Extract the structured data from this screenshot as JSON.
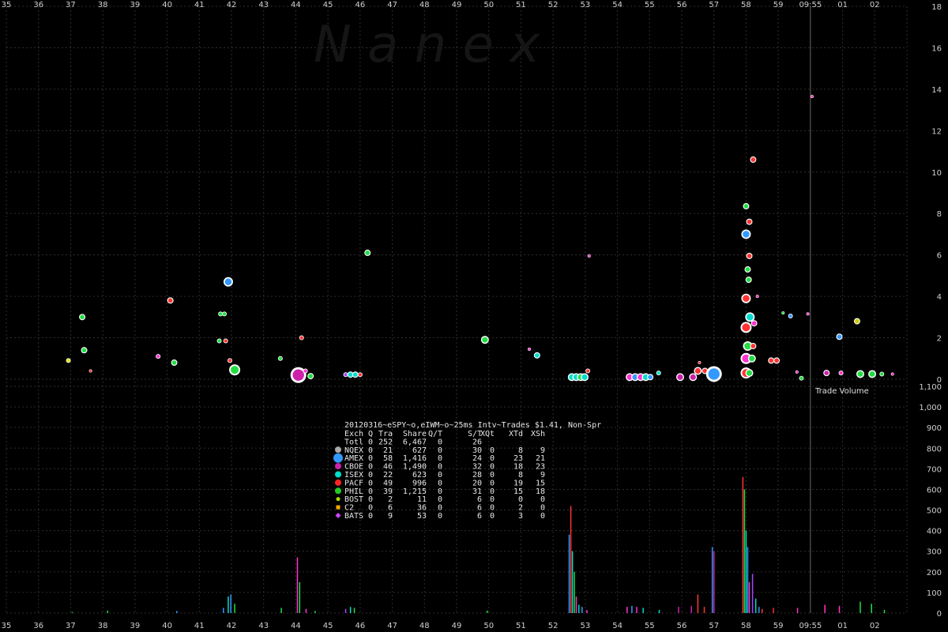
{
  "watermark": "Nanex",
  "chart_data": [
    {
      "type": "scatter",
      "title": "20120316~eSPY~o,eIWM~o~25ms Intv~Trades $1.41, Non-Spr",
      "x_tick_labels": [
        "35",
        "36",
        "37",
        "38",
        "39",
        "40",
        "41",
        "42",
        "43",
        "44",
        "45",
        "46",
        "47",
        "48",
        "49",
        "50",
        "51",
        "52",
        "53",
        "54",
        "55",
        "56",
        "57",
        "58",
        "59",
        "09:55",
        "01",
        "02"
      ],
      "y_tick_labels": [
        "0",
        "2",
        "4",
        "6",
        "8",
        "10",
        "12",
        "14",
        "16",
        "18"
      ],
      "ylim": [
        0,
        18
      ],
      "xlim": [
        0,
        28
      ],
      "marker": {
        "x": 25,
        "label": "09:55"
      },
      "points": [
        {
          "x": 1.93,
          "y": 0.9,
          "size": 3,
          "color": "#e0e000"
        },
        {
          "x": 2.36,
          "y": 3.0,
          "size": 4,
          "color": "#22dd44"
        },
        {
          "x": 2.42,
          "y": 1.4,
          "size": 4,
          "color": "#22dd44"
        },
        {
          "x": 2.62,
          "y": 0.4,
          "size": 2,
          "color": "#ff3333"
        },
        {
          "x": 4.72,
          "y": 1.1,
          "size": 3,
          "color": "#ff33cc"
        },
        {
          "x": 5.1,
          "y": 3.8,
          "size": 4,
          "color": "#ff3333"
        },
        {
          "x": 5.22,
          "y": 0.8,
          "size": 4,
          "color": "#22dd44"
        },
        {
          "x": 6.66,
          "y": 3.15,
          "size": 3,
          "color": "#22dd44"
        },
        {
          "x": 6.78,
          "y": 3.15,
          "size": 3,
          "color": "#22dd44"
        },
        {
          "x": 6.62,
          "y": 1.85,
          "size": 3,
          "color": "#22dd44"
        },
        {
          "x": 6.82,
          "y": 1.85,
          "size": 3,
          "color": "#ff3333"
        },
        {
          "x": 6.9,
          "y": 4.7,
          "size": 6,
          "color": "#3399ff"
        },
        {
          "x": 6.95,
          "y": 0.9,
          "size": 3,
          "color": "#ff3333"
        },
        {
          "x": 7.1,
          "y": 0.45,
          "size": 7,
          "color": "#22dd44"
        },
        {
          "x": 8.52,
          "y": 1.0,
          "size": 3,
          "color": "#22dd44"
        },
        {
          "x": 9.08,
          "y": 0.2,
          "size": 10,
          "color": "#cc22aa"
        },
        {
          "x": 9.3,
          "y": 0.4,
          "size": 3,
          "color": "#ff33cc"
        },
        {
          "x": 9.46,
          "y": 0.15,
          "size": 4,
          "color": "#22dd44"
        },
        {
          "x": 9.18,
          "y": 2.0,
          "size": 3,
          "color": "#ff3333"
        },
        {
          "x": 10.55,
          "y": 0.22,
          "size": 3,
          "color": "#aa44ff"
        },
        {
          "x": 10.7,
          "y": 0.22,
          "size": 4,
          "color": "#00ddcc"
        },
        {
          "x": 10.85,
          "y": 0.22,
          "size": 4,
          "color": "#00ddcc"
        },
        {
          "x": 11.0,
          "y": 0.22,
          "size": 3,
          "color": "#ff3333"
        },
        {
          "x": 11.23,
          "y": 6.1,
          "size": 4,
          "color": "#22dd44"
        },
        {
          "x": 14.88,
          "y": 1.9,
          "size": 5,
          "color": "#22dd44"
        },
        {
          "x": 16.26,
          "y": 1.45,
          "size": 2,
          "color": "#ff33cc"
        },
        {
          "x": 16.5,
          "y": 1.15,
          "size": 4,
          "color": "#00ddcc"
        },
        {
          "x": 17.58,
          "y": 0.1,
          "size": 5,
          "color": "#00ddcc"
        },
        {
          "x": 17.72,
          "y": 0.1,
          "size": 5,
          "color": "#00ddcc"
        },
        {
          "x": 17.86,
          "y": 0.1,
          "size": 5,
          "color": "#22dd44"
        },
        {
          "x": 17.98,
          "y": 0.1,
          "size": 5,
          "color": "#00ddcc"
        },
        {
          "x": 18.08,
          "y": 0.4,
          "size": 3,
          "color": "#ff3333"
        },
        {
          "x": 18.12,
          "y": 5.95,
          "size": 2,
          "color": "#ff33cc"
        },
        {
          "x": 19.38,
          "y": 0.1,
          "size": 5,
          "color": "#ff33cc"
        },
        {
          "x": 19.55,
          "y": 0.1,
          "size": 5,
          "color": "#3399ff"
        },
        {
          "x": 19.72,
          "y": 0.1,
          "size": 5,
          "color": "#ff33cc"
        },
        {
          "x": 19.88,
          "y": 0.1,
          "size": 5,
          "color": "#00ddcc"
        },
        {
          "x": 20.02,
          "y": 0.1,
          "size": 4,
          "color": "#3399ff"
        },
        {
          "x": 20.28,
          "y": 0.3,
          "size": 3,
          "color": "#00ddcc"
        },
        {
          "x": 20.95,
          "y": 0.1,
          "size": 5,
          "color": "#cc22aa"
        },
        {
          "x": 21.35,
          "y": 0.1,
          "size": 5,
          "color": "#cc22aa"
        },
        {
          "x": 21.5,
          "y": 0.4,
          "size": 5,
          "color": "#ff3333"
        },
        {
          "x": 21.55,
          "y": 0.8,
          "size": 2,
          "color": "#ff3333"
        },
        {
          "x": 21.72,
          "y": 0.4,
          "size": 4,
          "color": "#ff3333"
        },
        {
          "x": 22.0,
          "y": 0.25,
          "size": 10,
          "color": "#3399ff"
        },
        {
          "x": 23.0,
          "y": 0.3,
          "size": 7,
          "color": "#ff3333"
        },
        {
          "x": 23.1,
          "y": 0.3,
          "size": 5,
          "color": "#22dd44"
        },
        {
          "x": 23.0,
          "y": 1.0,
          "size": 7,
          "color": "#ff33cc"
        },
        {
          "x": 23.18,
          "y": 1.0,
          "size": 5,
          "color": "#22dd44"
        },
        {
          "x": 23.05,
          "y": 1.6,
          "size": 6,
          "color": "#22dd44"
        },
        {
          "x": 23.22,
          "y": 1.6,
          "size": 4,
          "color": "#ff3333"
        },
        {
          "x": 23.0,
          "y": 2.5,
          "size": 7,
          "color": "#ff3333"
        },
        {
          "x": 23.12,
          "y": 3.0,
          "size": 6,
          "color": "#00ddcc"
        },
        {
          "x": 23.25,
          "y": 2.7,
          "size": 4,
          "color": "#ff33cc"
        },
        {
          "x": 23.0,
          "y": 3.9,
          "size": 6,
          "color": "#ff3333"
        },
        {
          "x": 23.08,
          "y": 4.8,
          "size": 4,
          "color": "#22dd44"
        },
        {
          "x": 23.05,
          "y": 5.3,
          "size": 4,
          "color": "#22dd44"
        },
        {
          "x": 23.1,
          "y": 5.95,
          "size": 4,
          "color": "#ff3333"
        },
        {
          "x": 23.0,
          "y": 7.0,
          "size": 6,
          "color": "#3399ff"
        },
        {
          "x": 23.1,
          "y": 7.6,
          "size": 4,
          "color": "#ff3333"
        },
        {
          "x": 23.0,
          "y": 8.35,
          "size": 4,
          "color": "#22dd44"
        },
        {
          "x": 23.22,
          "y": 10.6,
          "size": 4,
          "color": "#ff3333"
        },
        {
          "x": 23.35,
          "y": 4.0,
          "size": 2,
          "color": "#ff33cc"
        },
        {
          "x": 23.78,
          "y": 0.9,
          "size": 4,
          "color": "#ff3333"
        },
        {
          "x": 23.95,
          "y": 0.9,
          "size": 4,
          "color": "#ff3333"
        },
        {
          "x": 24.15,
          "y": 3.2,
          "size": 2,
          "color": "#22dd44"
        },
        {
          "x": 24.38,
          "y": 3.05,
          "size": 3,
          "color": "#3399ff"
        },
        {
          "x": 24.58,
          "y": 0.35,
          "size": 2,
          "color": "#ff33cc"
        },
        {
          "x": 24.72,
          "y": 0.05,
          "size": 3,
          "color": "#22dd44"
        },
        {
          "x": 24.92,
          "y": 3.15,
          "size": 2,
          "color": "#ff33cc"
        },
        {
          "x": 25.05,
          "y": 13.65,
          "size": 2,
          "color": "#ff33cc"
        },
        {
          "x": 25.5,
          "y": 0.3,
          "size": 4,
          "color": "#cc22aa"
        },
        {
          "x": 25.95,
          "y": 0.3,
          "size": 3,
          "color": "#ff33cc"
        },
        {
          "x": 25.9,
          "y": 2.05,
          "size": 4,
          "color": "#3399ff"
        },
        {
          "x": 26.45,
          "y": 2.8,
          "size": 4,
          "color": "#cccc00"
        },
        {
          "x": 26.55,
          "y": 0.25,
          "size": 5,
          "color": "#22dd44"
        },
        {
          "x": 26.92,
          "y": 0.25,
          "size": 5,
          "color": "#22dd44"
        },
        {
          "x": 27.22,
          "y": 0.25,
          "size": 3,
          "color": "#22dd44"
        },
        {
          "x": 27.55,
          "y": 0.25,
          "size": 2,
          "color": "#ff33cc"
        }
      ]
    },
    {
      "type": "bar",
      "title": "Trade Volume",
      "y_tick_labels": [
        "0",
        "100",
        "200",
        "300",
        "400",
        "500",
        "600",
        "700",
        "800",
        "900",
        "1,000",
        "1,100"
      ],
      "ylim": [
        0,
        1100
      ],
      "bars": [
        {
          "x": 2.05,
          "v": 5,
          "color": "#22dd44"
        },
        {
          "x": 3.15,
          "v": 12,
          "color": "#22dd44"
        },
        {
          "x": 5.3,
          "v": 10,
          "color": "#3399ff"
        },
        {
          "x": 6.75,
          "v": 25,
          "color": "#3399ff"
        },
        {
          "x": 6.9,
          "v": 80,
          "color": "#00ddcc"
        },
        {
          "x": 6.98,
          "v": 90,
          "color": "#3399ff"
        },
        {
          "x": 7.1,
          "v": 45,
          "color": "#22dd44"
        },
        {
          "x": 8.55,
          "v": 25,
          "color": "#22dd44"
        },
        {
          "x": 9.05,
          "v": 270,
          "color": "#ff33cc"
        },
        {
          "x": 9.12,
          "v": 150,
          "color": "#22dd44"
        },
        {
          "x": 9.32,
          "v": 20,
          "color": "#ff33cc"
        },
        {
          "x": 9.6,
          "v": 10,
          "color": "#22dd44"
        },
        {
          "x": 10.55,
          "v": 20,
          "color": "#aa44ff"
        },
        {
          "x": 10.7,
          "v": 30,
          "color": "#00ddcc"
        },
        {
          "x": 10.82,
          "v": 25,
          "color": "#22dd44"
        },
        {
          "x": 14.95,
          "v": 12,
          "color": "#22dd44"
        },
        {
          "x": 17.5,
          "v": 380,
          "color": "#3399ff"
        },
        {
          "x": 17.55,
          "v": 520,
          "color": "#ff3333"
        },
        {
          "x": 17.6,
          "v": 300,
          "color": "#00ddcc"
        },
        {
          "x": 17.66,
          "v": 200,
          "color": "#22dd44"
        },
        {
          "x": 17.72,
          "v": 80,
          "color": "#ff33cc"
        },
        {
          "x": 17.8,
          "v": 40,
          "color": "#00ddcc"
        },
        {
          "x": 17.9,
          "v": 30,
          "color": "#3399ff"
        },
        {
          "x": 18.05,
          "v": 15,
          "color": "#ff33cc"
        },
        {
          "x": 19.3,
          "v": 30,
          "color": "#ff33cc"
        },
        {
          "x": 19.45,
          "v": 35,
          "color": "#3399ff"
        },
        {
          "x": 19.6,
          "v": 30,
          "color": "#ff33cc"
        },
        {
          "x": 19.8,
          "v": 25,
          "color": "#00ddcc"
        },
        {
          "x": 20.3,
          "v": 15,
          "color": "#00ddcc"
        },
        {
          "x": 20.9,
          "v": 30,
          "color": "#cc22aa"
        },
        {
          "x": 21.3,
          "v": 35,
          "color": "#cc22aa"
        },
        {
          "x": 21.5,
          "v": 90,
          "color": "#ff3333"
        },
        {
          "x": 21.7,
          "v": 30,
          "color": "#ff3333"
        },
        {
          "x": 21.95,
          "v": 320,
          "color": "#3399ff"
        },
        {
          "x": 22.0,
          "v": 300,
          "color": "#cc22aa"
        },
        {
          "x": 22.9,
          "v": 660,
          "color": "#ff3333"
        },
        {
          "x": 22.95,
          "v": 600,
          "color": "#22dd44"
        },
        {
          "x": 23.0,
          "v": 400,
          "color": "#00ddcc"
        },
        {
          "x": 23.05,
          "v": 320,
          "color": "#3399ff"
        },
        {
          "x": 23.1,
          "v": 150,
          "color": "#ff33cc"
        },
        {
          "x": 23.2,
          "v": 190,
          "color": "#aa44ff"
        },
        {
          "x": 23.3,
          "v": 70,
          "color": "#00ddcc"
        },
        {
          "x": 23.4,
          "v": 30,
          "color": "#3399ff"
        },
        {
          "x": 23.5,
          "v": 20,
          "color": "#ff3333"
        },
        {
          "x": 23.85,
          "v": 25,
          "color": "#ff3333"
        },
        {
          "x": 24.6,
          "v": 25,
          "color": "#ff33cc"
        },
        {
          "x": 25.45,
          "v": 40,
          "color": "#ff33cc"
        },
        {
          "x": 25.9,
          "v": 35,
          "color": "#ff33cc"
        },
        {
          "x": 26.55,
          "v": 55,
          "color": "#22dd44"
        },
        {
          "x": 26.9,
          "v": 45,
          "color": "#22dd44"
        },
        {
          "x": 27.3,
          "v": 15,
          "color": "#22dd44"
        }
      ]
    }
  ],
  "stats": {
    "header": [
      "Exch",
      "Q",
      "Tra",
      "Share",
      "Q/T",
      "S/T",
      "XQt",
      "XTd",
      "XSh"
    ],
    "rows": [
      {
        "marker": "none",
        "color": "#000000",
        "cells": [
          "Totl",
          "0",
          "252",
          "6,467",
          "0",
          "26",
          "",
          "",
          ""
        ]
      },
      {
        "marker": "circle",
        "color": "#aaaaaa",
        "cells": [
          "NQEX",
          "0",
          "21",
          "627",
          "0",
          "30",
          "0",
          "8",
          "9"
        ]
      },
      {
        "marker": "circle-lg",
        "color": "#3399ff",
        "cells": [
          "AMEX",
          "0",
          "58",
          "1,416",
          "0",
          "24",
          "0",
          "23",
          "21"
        ]
      },
      {
        "marker": "circle",
        "color": "#cc22aa",
        "cells": [
          "CBOE",
          "0",
          "46",
          "1,490",
          "0",
          "32",
          "0",
          "18",
          "23"
        ]
      },
      {
        "marker": "circle",
        "color": "#00ddcc",
        "cells": [
          "ISEX",
          "0",
          "22",
          "623",
          "0",
          "28",
          "0",
          "8",
          "9"
        ]
      },
      {
        "marker": "circle",
        "color": "#ff2222",
        "cells": [
          "PACF",
          "0",
          "49",
          "996",
          "0",
          "20",
          "0",
          "19",
          "15"
        ]
      },
      {
        "marker": "circle",
        "color": "#22cc22",
        "cells": [
          "PHIL",
          "0",
          "39",
          "1,215",
          "0",
          "31",
          "0",
          "15",
          "18"
        ]
      },
      {
        "marker": "circle-sm",
        "color": "#aadd00",
        "cells": [
          "BOST",
          "0",
          "2",
          "11",
          "0",
          "6",
          "0",
          "0",
          "0"
        ]
      },
      {
        "marker": "square",
        "color": "#ffaa00",
        "cells": [
          "C2",
          "0",
          "6",
          "36",
          "0",
          "6",
          "0",
          "2",
          "0"
        ]
      },
      {
        "marker": "diamond",
        "color": "#cc44ff",
        "cells": [
          "BATS",
          "0",
          "9",
          "53",
          "0",
          "6",
          "0",
          "3",
          "0"
        ]
      }
    ]
  },
  "colors": {
    "grid": "#2e2e2e",
    "marker_line": "#666666",
    "background": "#000000"
  }
}
